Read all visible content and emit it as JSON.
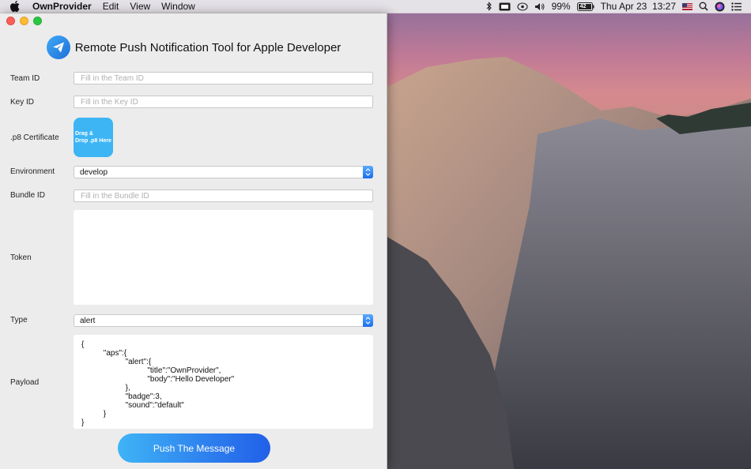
{
  "menubar": {
    "app_name": "OwnProvider",
    "menus": [
      "Edit",
      "View",
      "Window"
    ],
    "battery_percent": "99%",
    "battery_level": "42",
    "clock": "Thu Apr 23  13:27"
  },
  "window": {
    "title": "Remote Push Notification Tool for Apple Developer",
    "team_id": {
      "label": "Team ID",
      "placeholder": "Fill in the Team ID",
      "value": ""
    },
    "key_id": {
      "label": "Key ID",
      "placeholder": "Fill in the Key ID",
      "value": ""
    },
    "certificate": {
      "label": ".p8 Certificate",
      "drop_text_line1": "Drag &",
      "drop_text_line2": "Drop .p8 Here"
    },
    "environment": {
      "label": "Environment",
      "value": "develop"
    },
    "bundle_id": {
      "label": "Bundle ID",
      "placeholder": "Fill in the Bundle ID",
      "value": ""
    },
    "token": {
      "label": "Token",
      "value": ""
    },
    "type": {
      "label": "Type",
      "value": "alert"
    },
    "payload": {
      "label": "Payload",
      "text": "{\n          \"aps\":{\n                    \"alert\":{\n                              \"title\":\"OwnProvider\",\n                              \"body\":\"Hello Developer\"\n                    },\n                    \"badge\":3,\n                    \"sound\":\"default\"\n          }\n}"
    },
    "push_button": "Push The Message"
  },
  "colors": {
    "accent": "#3db5f5",
    "button_gradient_end": "#2160e8"
  }
}
